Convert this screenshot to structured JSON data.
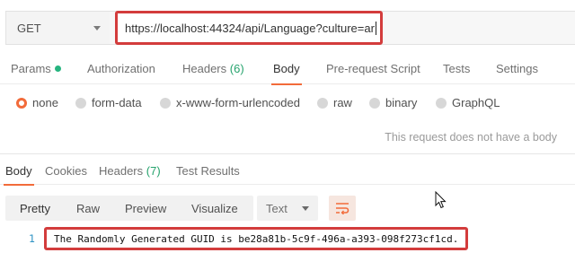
{
  "request": {
    "method": "GET",
    "url": "https://localhost:44324/api/Language?culture=ar"
  },
  "request_tabs": [
    {
      "label": "Params",
      "active": false,
      "dot": true
    },
    {
      "label": "Authorization",
      "active": false
    },
    {
      "label": "Headers",
      "count": "(6)",
      "active": false
    },
    {
      "label": "Body",
      "active": true
    },
    {
      "label": "Pre-request Script",
      "active": false
    },
    {
      "label": "Tests",
      "active": false
    },
    {
      "label": "Settings",
      "active": false
    }
  ],
  "body_types": [
    {
      "label": "none",
      "selected": true
    },
    {
      "label": "form-data",
      "selected": false
    },
    {
      "label": "x-www-form-urlencoded",
      "selected": false
    },
    {
      "label": "raw",
      "selected": false
    },
    {
      "label": "binary",
      "selected": false
    },
    {
      "label": "GraphQL",
      "selected": false
    }
  ],
  "no_body_message": "This request does not have a body",
  "response_tabs": [
    {
      "label": "Body",
      "active": true
    },
    {
      "label": "Cookies",
      "active": false
    },
    {
      "label": "Headers",
      "count": "(7)",
      "active": false
    },
    {
      "label": "Test Results",
      "active": false
    }
  ],
  "view_modes": [
    {
      "label": "Pretty",
      "active": true
    },
    {
      "label": "Raw",
      "active": false
    },
    {
      "label": "Preview",
      "active": false
    },
    {
      "label": "Visualize",
      "active": false
    }
  ],
  "format": "Text",
  "response_lines": [
    {
      "no": "1",
      "text": "The Randomly Generated GUID is be28a81b-5c9f-496a-a393-098f273cf1cd."
    }
  ],
  "colors": {
    "accent": "#f26b3a",
    "highlight_border": "#d33c3c",
    "dot_green": "#26b47f",
    "line_number": "#2f93c4"
  },
  "icons": {
    "wrap": "wrap-lines-icon",
    "cursor": "mouse-pointer-icon"
  }
}
